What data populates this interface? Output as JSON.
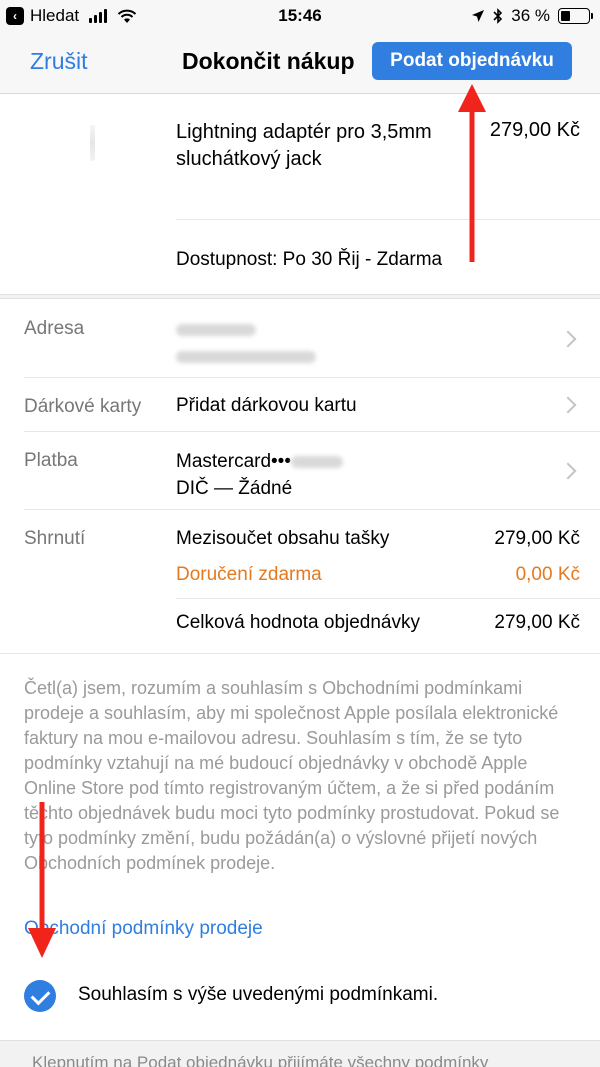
{
  "status_bar": {
    "back_app": "Hledat",
    "time": "15:46",
    "battery": "36 %",
    "battery_level": 0.36,
    "icons": [
      "signal-icon",
      "wifi-icon",
      "location-icon",
      "bluetooth-icon",
      "battery-icon"
    ]
  },
  "nav": {
    "cancel_label": "Zrušit",
    "title": "Dokončit nákup",
    "submit_label": "Podat objednávku"
  },
  "product": {
    "name": "Lightning adaptér pro 3,5mm sluchátkový jack",
    "price": "279,00 Kč",
    "availability": "Dostupnost: Po 30 Řij - Zdarma"
  },
  "details": {
    "address_label": "Adresa",
    "gift_label": "Dárkové karty",
    "gift_value": "Přidat dárkovou kartu",
    "payment_label": "Platba",
    "payment_card": "Mastercard•••",
    "payment_tax": "DIČ — Žádné",
    "summary_label": "Shrnutí",
    "subtotal_label": "Mezisoučet obsahu tašky",
    "subtotal_value": "279,00 Kč",
    "shipping_label": "Doručení zdarma",
    "shipping_value": "0,00 Kč",
    "total_label": "Celková hodnota objednávky",
    "total_value": "279,00 Kč"
  },
  "legal": {
    "text": "Četl(a) jsem, rozumím a souhlasím s Obchodními podmínkami prodeje a souhlasím, aby mi společnost Apple posílala elektronické faktury na mou e-mailovou adresu. Souhlasím s tím, že se tyto podmínky vztahují na mé budoucí objednávky v obchodě Apple Online Store pod tímto registrovaným účtem, a že si před podáním těchto objednávek budu moci tyto podmínky prostudovat. Pokud se tyto podmínky změní, budu požádán(a) o výslovné přijetí nových Obchodních podmínek prodeje.",
    "link": "Obchodní podmínky prodeje",
    "agree": "Souhlasím s výše uvedenými podmínkami.",
    "agree_checked": true
  },
  "footer": {
    "text": "Klepnutím na Podat objednávku přijímáte všechny podmínky"
  },
  "colors": {
    "accent": "#2f7ee0",
    "orange": "#e37a1f",
    "annotation_red": "#f0241b"
  }
}
